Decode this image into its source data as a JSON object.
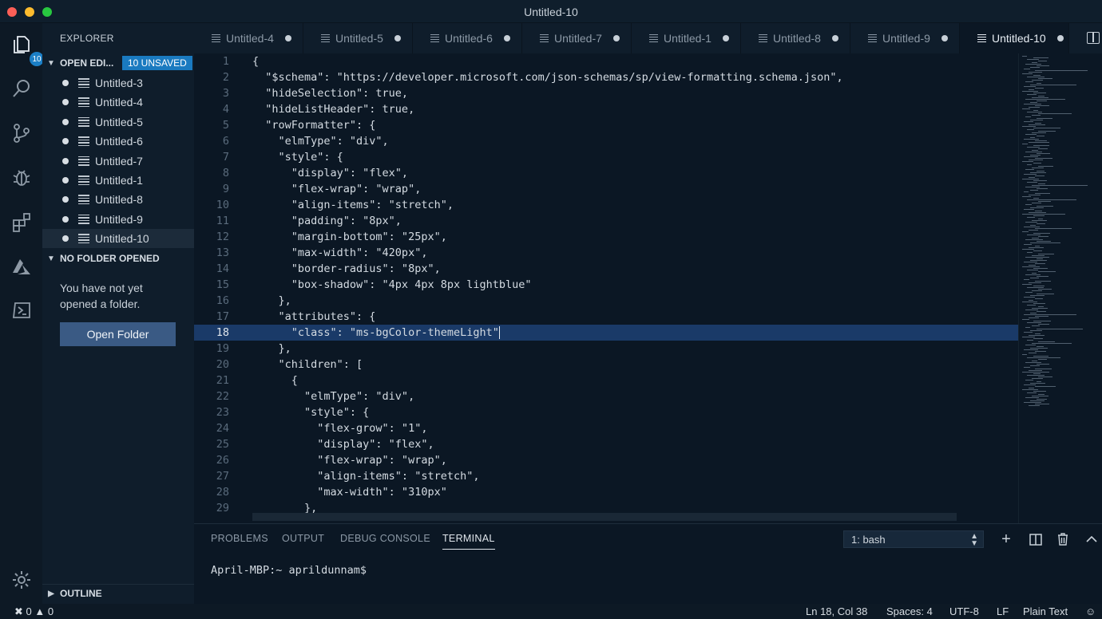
{
  "window": {
    "title": "Untitled-10"
  },
  "activity_bar": {
    "explorer_badge": "10",
    "icons": [
      "files-icon",
      "search-icon",
      "source-control-icon",
      "debug-icon",
      "extensions-icon",
      "azure-icon",
      "terminal-icon",
      "settings-gear-icon"
    ]
  },
  "sidebar": {
    "title": "EXPLORER",
    "open_editors": {
      "label": "OPEN EDI...",
      "badge": "10 UNSAVED",
      "files": [
        "Untitled-3",
        "Untitled-4",
        "Untitled-5",
        "Untitled-6",
        "Untitled-7",
        "Untitled-1",
        "Untitled-8",
        "Untitled-9",
        "Untitled-10"
      ],
      "active": "Untitled-10"
    },
    "no_folder": {
      "label": "NO FOLDER OPENED",
      "message": "You have not yet opened a folder.",
      "button": "Open Folder"
    },
    "outline_label": "OUTLINE"
  },
  "tabs": [
    {
      "label": "Untitled-4",
      "active": false
    },
    {
      "label": "Untitled-5",
      "active": false
    },
    {
      "label": "Untitled-6",
      "active": false
    },
    {
      "label": "Untitled-7",
      "active": false
    },
    {
      "label": "Untitled-1",
      "active": false
    },
    {
      "label": "Untitled-8",
      "active": false
    },
    {
      "label": "Untitled-9",
      "active": false
    },
    {
      "label": "Untitled-10",
      "active": true
    }
  ],
  "editor": {
    "current_line": 18,
    "lines": [
      "{",
      "  \"$schema\": \"https://developer.microsoft.com/json-schemas/sp/view-formatting.schema.json\",",
      "  \"hideSelection\": true,",
      "  \"hideListHeader\": true,",
      "  \"rowFormatter\": {",
      "    \"elmType\": \"div\",",
      "    \"style\": {",
      "      \"display\": \"flex\",",
      "      \"flex-wrap\": \"wrap\",",
      "      \"align-items\": \"stretch\",",
      "      \"padding\": \"8px\",",
      "      \"margin-bottom\": \"25px\",",
      "      \"max-width\": \"420px\",",
      "      \"border-radius\": \"8px\",",
      "      \"box-shadow\": \"4px 4px 8px lightblue\"",
      "    },",
      "    \"attributes\": {",
      "      \"class\": \"ms-bgColor-themeLight\"",
      "    },",
      "    \"children\": [",
      "      {",
      "        \"elmType\": \"div\",",
      "        \"style\": {",
      "          \"flex-grow\": \"1\",",
      "          \"display\": \"flex\",",
      "          \"flex-wrap\": \"wrap\",",
      "          \"align-items\": \"stretch\",",
      "          \"max-width\": \"310px\"",
      "        },"
    ]
  },
  "panel": {
    "tabs": [
      "PROBLEMS",
      "OUTPUT",
      "DEBUG CONSOLE",
      "TERMINAL"
    ],
    "active_tab": "TERMINAL",
    "terminal_select": "1: bash",
    "terminal_prompt": "April-MBP:~ aprildunnam$"
  },
  "status_bar": {
    "errors": "0",
    "warnings": "0",
    "position": "Ln 18, Col 38",
    "spaces": "Spaces: 4",
    "encoding": "UTF-8",
    "eol": "LF",
    "language": "Plain Text"
  }
}
